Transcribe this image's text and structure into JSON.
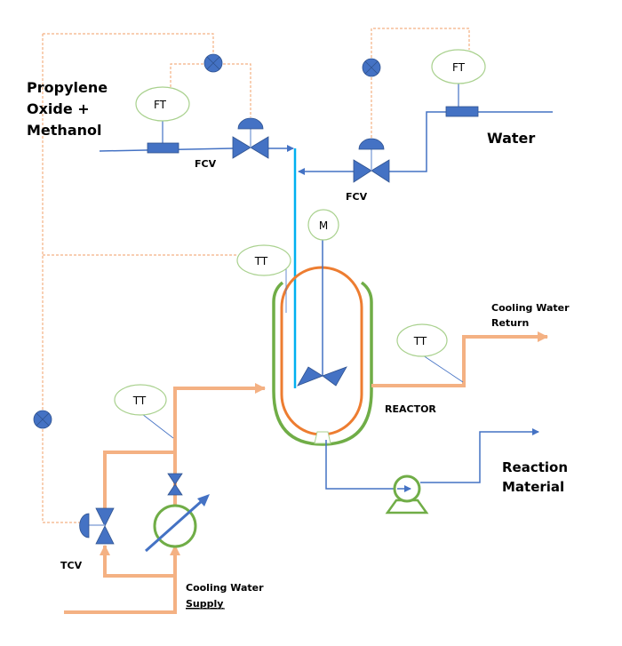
{
  "labels": {
    "feed1_line1": "Propylene",
    "feed1_line2": "Oxide +",
    "feed1_line3": "Methanol",
    "feed2": "Water",
    "fcv1": "FCV",
    "fcv2": "FCV",
    "tcv": "TCV",
    "reactor": "REACTOR",
    "cw_return_line1": "Cooling Water",
    "cw_return_line2": "Return",
    "cw_supply_line1": "Cooling Water",
    "cw_supply_line2": "Supply",
    "product_line1": "Reaction",
    "product_line2": "Material"
  },
  "instruments": {
    "ft1": "FT",
    "ft2": "FT",
    "motor": "M",
    "tt1": "TT",
    "tt2": "TT",
    "tt3": "TT"
  },
  "colors": {
    "process_line": "#4472c4",
    "feed_line": "#00b0f0",
    "cooling_water": "#f4b183",
    "signal_line": "#f4b183",
    "reactor_vessel": "#ed7d31",
    "jacket": "#70ad47",
    "instrument_bubble": "#a9d18e"
  }
}
